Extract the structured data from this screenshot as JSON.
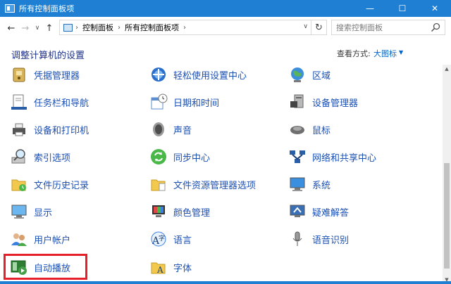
{
  "window": {
    "title": "所有控制面板项",
    "controls": {
      "minimize": "—",
      "maximize": "☐",
      "close": "✕"
    }
  },
  "navigation": {
    "back": "←",
    "forward": "→",
    "recent": "∨",
    "up": "↑",
    "breadcrumb": [
      "控制面板",
      "所有控制面板项"
    ],
    "separator": "›",
    "refresh": "↻",
    "search_placeholder": "搜索控制面板"
  },
  "header": {
    "title": "调整计算机的设置",
    "view_by_label": "查看方式:",
    "view_by_value": "大图标",
    "caret": "▼"
  },
  "items": [
    {
      "id": "credential-manager",
      "label": "凭据管理器",
      "icon": "credential-manager-icon"
    },
    {
      "id": "ease-of-access",
      "label": "轻松使用设置中心",
      "icon": "ease-of-access-icon"
    },
    {
      "id": "region",
      "label": "区域",
      "icon": "region-icon"
    },
    {
      "id": "taskbar",
      "label": "任务栏和导航",
      "icon": "taskbar-icon"
    },
    {
      "id": "date-time",
      "label": "日期和时间",
      "icon": "date-time-icon"
    },
    {
      "id": "device-manager",
      "label": "设备管理器",
      "icon": "device-manager-icon"
    },
    {
      "id": "devices-printers",
      "label": "设备和打印机",
      "icon": "printer-icon"
    },
    {
      "id": "sound",
      "label": "声音",
      "icon": "speaker-icon"
    },
    {
      "id": "mouse",
      "label": "鼠标",
      "icon": "mouse-icon"
    },
    {
      "id": "indexing",
      "label": "索引选项",
      "icon": "indexing-icon"
    },
    {
      "id": "sync-center",
      "label": "同步中心",
      "icon": "sync-icon"
    },
    {
      "id": "network-sharing",
      "label": "网络和共享中心",
      "icon": "network-icon"
    },
    {
      "id": "file-history",
      "label": "文件历史记录",
      "icon": "file-history-icon"
    },
    {
      "id": "explorer-options",
      "label": "文件资源管理器选项",
      "icon": "folder-options-icon"
    },
    {
      "id": "system",
      "label": "系统",
      "icon": "system-icon"
    },
    {
      "id": "display",
      "label": "显示",
      "icon": "display-icon"
    },
    {
      "id": "color-management",
      "label": "颜色管理",
      "icon": "color-management-icon"
    },
    {
      "id": "troubleshooting",
      "label": "疑难解答",
      "icon": "troubleshooting-icon"
    },
    {
      "id": "user-accounts",
      "label": "用户帐户",
      "icon": "user-accounts-icon"
    },
    {
      "id": "language",
      "label": "语言",
      "icon": "language-icon"
    },
    {
      "id": "speech-recognition",
      "label": "语音识别",
      "icon": "microphone-icon"
    },
    {
      "id": "autoplay",
      "label": "自动播放",
      "icon": "autoplay-icon"
    },
    {
      "id": "fonts",
      "label": "字体",
      "icon": "fonts-icon"
    }
  ],
  "colors": {
    "titlebar": "#1f7fd2",
    "link": "#1b50b4",
    "heading": "#1e3287",
    "highlight": "#e5202a"
  }
}
